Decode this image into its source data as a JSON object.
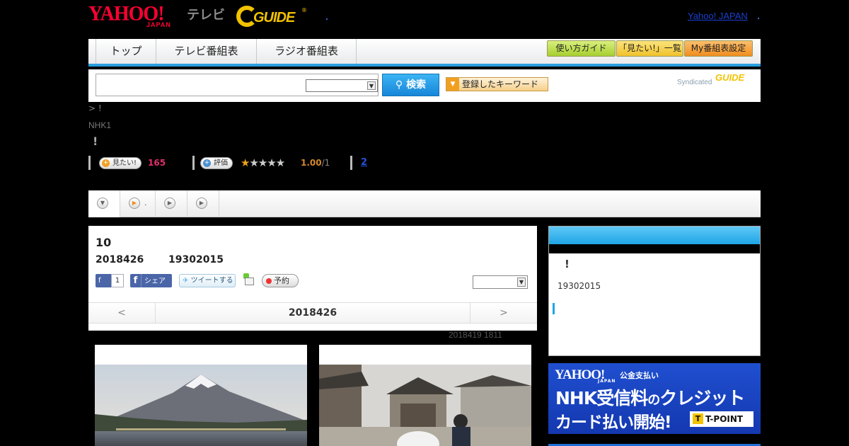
{
  "header": {
    "yahoo_logo": "YAHOO!",
    "yahoo_japan": "JAPAN",
    "tv_label": "テレビ",
    "gguide_logo": "GUIDE",
    "gguide_reg": "®",
    "yahoo_japan_link": "Yahoo! JAPAN"
  },
  "nav": {
    "tabs": [
      "トップ",
      "テレビ番組表",
      "ラジオ番組表"
    ],
    "buttons": [
      "使い方ガイド",
      "「見たい!」一覧",
      "My番組表設定"
    ]
  },
  "search": {
    "button_label": "検索",
    "keyword_button": "登録したキーワード",
    "syndicated": "Syndicated",
    "syndicated_logo": "GUIDE"
  },
  "program": {
    "breadcrumb": "> !",
    "channel": "NHK1",
    "title": "!",
    "want_label": "見たい!",
    "want_count": "165",
    "rate_label": "評価",
    "stars_on": "★",
    "stars_off": "★★★★",
    "rating": "1.00",
    "rating_den": "/1",
    "review_count": "2"
  },
  "tabs": {
    "t2_label": "."
  },
  "episode": {
    "number": "10",
    "date": "2018426",
    "time": "19302015",
    "fb_like": "1",
    "fb_share": "シェア",
    "tweet": "ツイートする",
    "reserve": "予約",
    "prev": "<",
    "current_day": "2018426",
    "next": ">",
    "updated": "2018419  1811"
  },
  "sidebar": {
    "mark": "!",
    "time": "19302015"
  },
  "banner": {
    "yahoo": "YAHOO!",
    "japan": "JAPAN",
    "subtitle": "公金支払い",
    "line1_a": "NHK受信料",
    "line1_b": "の",
    "line1_c": "クレジット",
    "line2": "カード払い開始!",
    "tpoint_t": "T",
    "tpoint": "T-POINT"
  },
  "colors": {
    "accent_blue": "#1ea5e6",
    "yahoo_red": "#ff0033",
    "gguide_yellow": "#f2c200",
    "want_pink": "#e0306a"
  }
}
